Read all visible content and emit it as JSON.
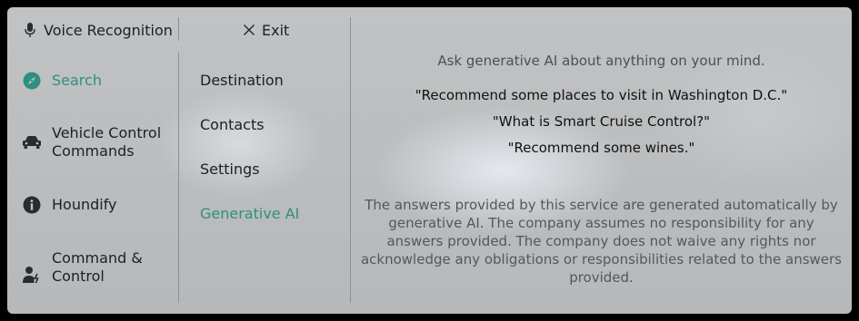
{
  "header": {
    "voice_label": "Voice Recognition",
    "exit_label": "Exit"
  },
  "sidebar": {
    "items": [
      {
        "label": "Search",
        "icon": "compass-icon",
        "active": true
      },
      {
        "label": "Vehicle Control\nCommands",
        "icon": "car-icon",
        "active": false
      },
      {
        "label": "Houndify",
        "icon": "info-icon",
        "active": false
      },
      {
        "label": "Command &\nControl",
        "icon": "person-voice-icon",
        "active": false
      }
    ]
  },
  "submenu": {
    "items": [
      {
        "label": "Destination",
        "active": false
      },
      {
        "label": "Contacts",
        "active": false
      },
      {
        "label": "Settings",
        "active": false
      },
      {
        "label": "Generative AI",
        "active": true
      }
    ]
  },
  "main": {
    "prompt": "Ask generative AI about anything on your mind.",
    "examples": [
      "\"Recommend some places to visit in Washington D.C.\"",
      "\"What is Smart Cruise Control?\"",
      "\"Recommend some wines.\""
    ],
    "disclaimer": "The answers provided by this service are generated automatically by generative AI. The company assumes no responsibility for any answers provided. The company does not waive any rights nor acknowledge any obligations or responsibilities related to the answers provided."
  },
  "colors": {
    "accent": "#2f8f7e",
    "text": "#1e1f21",
    "background": "#bfc1c3"
  }
}
